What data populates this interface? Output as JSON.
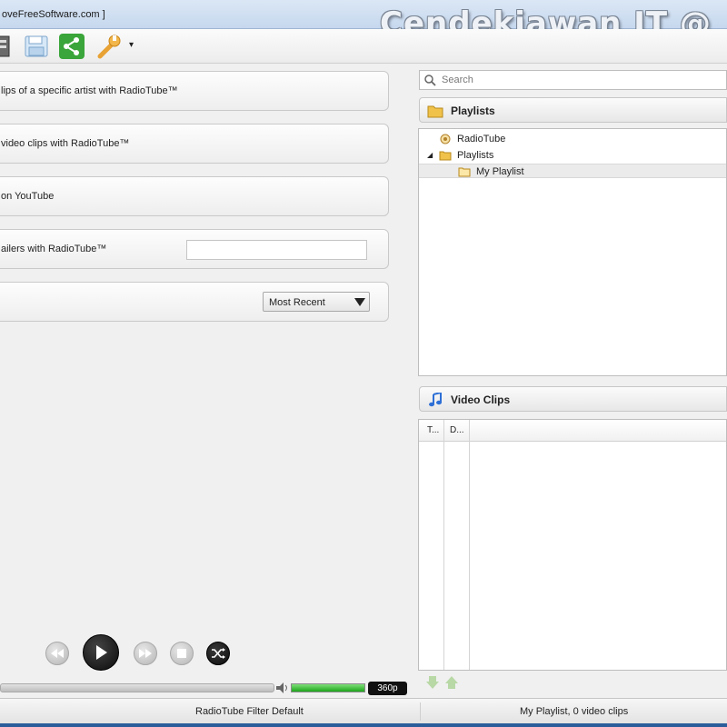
{
  "window": {
    "title": "oveFreeSoftware.com ]",
    "watermark": "Cendekiawan IT @"
  },
  "toolbar": {
    "icons": [
      "playlist-icon",
      "save-icon",
      "share-icon",
      "settings-wrench-icon"
    ],
    "dropdown_glyph": "▾"
  },
  "actions": {
    "artist": "lips of a specific artist with RadioTube™",
    "video": "video clips with RadioTube™",
    "youtube": "on YouTube",
    "trailers": "ailers with RadioTube™",
    "trailers_input_value": "",
    "sort_selected": "Most Recent"
  },
  "player": {
    "quality": "360p",
    "volume_fraction": 1.0,
    "seek_fraction": 0.0
  },
  "search": {
    "placeholder": "Search"
  },
  "playlists": {
    "header": "Playlists",
    "tree": [
      {
        "label": "RadioTube",
        "icon": "radiotube-icon"
      },
      {
        "label": "Playlists",
        "icon": "folder-icon",
        "expanded": true
      },
      {
        "label": "My Playlist",
        "icon": "folder-open-icon",
        "selected": true
      }
    ]
  },
  "video_clips": {
    "header": "Video Clips",
    "columns": [
      "T...",
      "D..."
    ]
  },
  "status": {
    "left": "RadioTube Filter Default",
    "right": "My Playlist, 0 video clips"
  },
  "colors": {
    "accent_green": "#1ea51b",
    "folder_yellow": "#f0c24a",
    "share_green": "#3aa53a",
    "wrench_orange": "#e8a234",
    "music_blue": "#2d6fd6"
  }
}
